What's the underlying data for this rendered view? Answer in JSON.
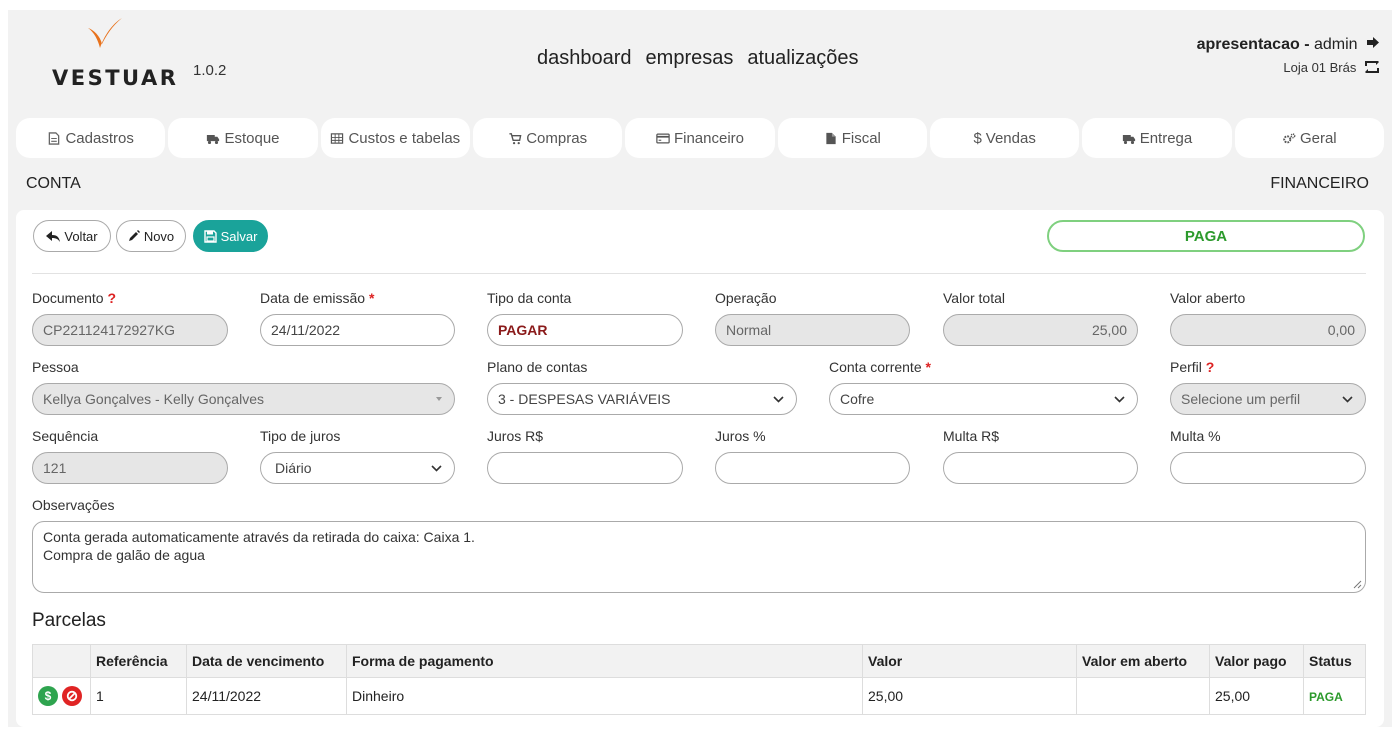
{
  "brand": {
    "name": "VESTUAR",
    "version": "1.0.2"
  },
  "topnav": [
    "dashboard",
    "empresas",
    "atualizações"
  ],
  "user": {
    "login": "apresentacao",
    "separator": " - ",
    "role": "admin",
    "store": "Loja 01 Brás"
  },
  "modules": [
    {
      "label": "Cadastros",
      "icon": "document-icon"
    },
    {
      "label": "Estoque",
      "icon": "truck-icon"
    },
    {
      "label": "Custos e tabelas",
      "icon": "table-icon"
    },
    {
      "label": "Compras",
      "icon": "cart-icon"
    },
    {
      "label": "Financeiro",
      "icon": "credit-card-icon"
    },
    {
      "label": "Fiscal",
      "icon": "file-icon"
    },
    {
      "label": "Vendas",
      "icon": "dollar-icon"
    },
    {
      "label": "Entrega",
      "icon": "truck-icon"
    },
    {
      "label": "Geral",
      "icon": "gears-icon"
    }
  ],
  "section": {
    "left": "CONTA",
    "right": "FINANCEIRO"
  },
  "actions": {
    "back": "Voltar",
    "new": "Novo",
    "save": "Salvar"
  },
  "status": "PAGA",
  "form": {
    "documento": {
      "label": "Documento",
      "mark": "?",
      "value": "CP221124172927KG"
    },
    "data_emissao": {
      "label": "Data de emissão",
      "mark": "*",
      "value": "24/11/2022"
    },
    "tipo_conta": {
      "label": "Tipo da conta",
      "value": "PAGAR"
    },
    "operacao": {
      "label": "Operação",
      "value": "Normal"
    },
    "valor_total": {
      "label": "Valor total",
      "value": "25,00"
    },
    "valor_aberto": {
      "label": "Valor aberto",
      "value": "0,00"
    },
    "pessoa": {
      "label": "Pessoa",
      "value": "Kellya Gonçalves - Kelly Gonçalves"
    },
    "plano_contas": {
      "label": "Plano de contas",
      "value": "3 - DESPESAS VARIÁVEIS"
    },
    "conta_corrente": {
      "label": "Conta corrente",
      "mark": "*",
      "value": "Cofre"
    },
    "perfil": {
      "label": "Perfil",
      "mark": "?",
      "value": "Selecione um perfil"
    },
    "sequencia": {
      "label": "Sequência",
      "value": "121"
    },
    "tipo_juros": {
      "label": "Tipo de juros",
      "value": "Diário"
    },
    "juros_rs": {
      "label": "Juros R$",
      "value": ""
    },
    "juros_pct": {
      "label": "Juros %",
      "value": ""
    },
    "multa_rs": {
      "label": "Multa R$",
      "value": ""
    },
    "multa_pct": {
      "label": "Multa %",
      "value": ""
    },
    "observacoes": {
      "label": "Observações",
      "line1": "Conta gerada automaticamente através da retirada do caixa: Caixa 1.",
      "line2": "Compra de galão de agua"
    }
  },
  "parcelas": {
    "title": "Parcelas",
    "columns": [
      "",
      "Referência",
      "Data de vencimento",
      "Forma de pagamento",
      "Valor",
      "Valor em aberto",
      "Valor pago",
      "Status"
    ],
    "rows": [
      {
        "referencia": "1",
        "vencimento": "24/11/2022",
        "forma": "Dinheiro",
        "valor": "25,00",
        "aberto": "",
        "pago": "25,00",
        "status": "PAGA"
      }
    ]
  },
  "colors": {
    "accent": "#1aa39a",
    "status_green": "#2c9a2c",
    "brand_orange": "#e8721c"
  }
}
